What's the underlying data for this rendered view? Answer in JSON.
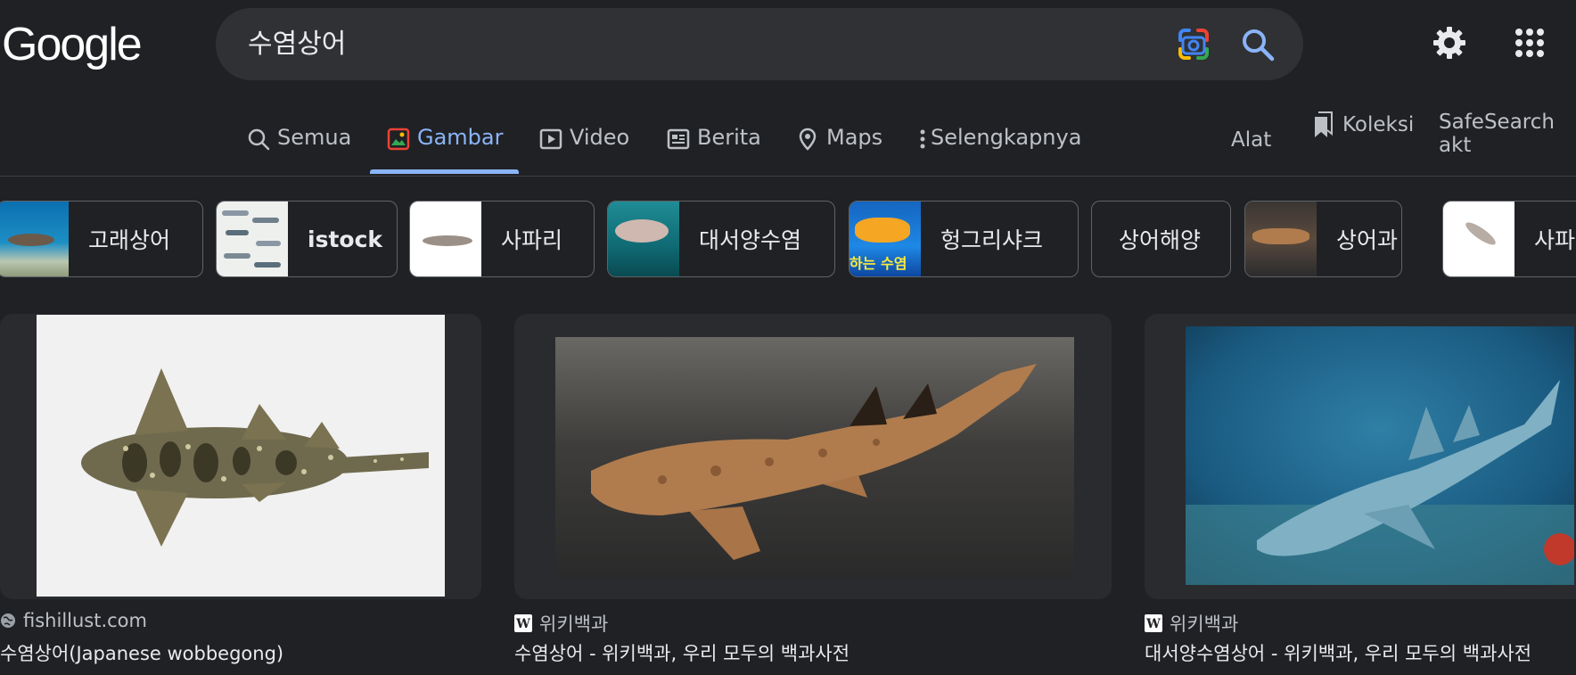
{
  "logo": "Google",
  "search": {
    "query": "수염상어"
  },
  "tabs": [
    {
      "label": "Semua",
      "icon": "search-icon"
    },
    {
      "label": "Gambar",
      "icon": "image-icon",
      "active": true
    },
    {
      "label": "Video",
      "icon": "video-icon"
    },
    {
      "label": "Berita",
      "icon": "news-icon"
    },
    {
      "label": "Maps",
      "icon": "map-pin-icon"
    },
    {
      "label": "Selengkapnya",
      "icon": "more-vert-icon"
    }
  ],
  "tools_label": "Alat",
  "collections_label": "Koleksi",
  "safesearch_label": "SafeSearch akt",
  "chips": [
    {
      "label": "고래상어"
    },
    {
      "label": "istock"
    },
    {
      "label": "사파리"
    },
    {
      "label": "대서양수염"
    },
    {
      "label": "헝그리샤크",
      "thumb_text": "하는 수염"
    },
    {
      "label": "상어해양"
    },
    {
      "label": "상어과"
    },
    {
      "label": "사파"
    }
  ],
  "results": [
    {
      "source": "fishillust.com",
      "source_icon": "globe-icon",
      "title": "수염상어(Japanese wobbegong)"
    },
    {
      "source": "위키백과",
      "source_icon": "wikipedia-icon",
      "title": "수염상어 - 위키백과, 우리 모두의 백과사전"
    },
    {
      "source": "위키백과",
      "source_icon": "wikipedia-icon",
      "title": "대서양수염상어 - 위키백과, 우리 모두의 백과사전"
    }
  ],
  "colors": {
    "accent": "#8ab4f8",
    "background": "#202124",
    "surface": "#303134"
  }
}
